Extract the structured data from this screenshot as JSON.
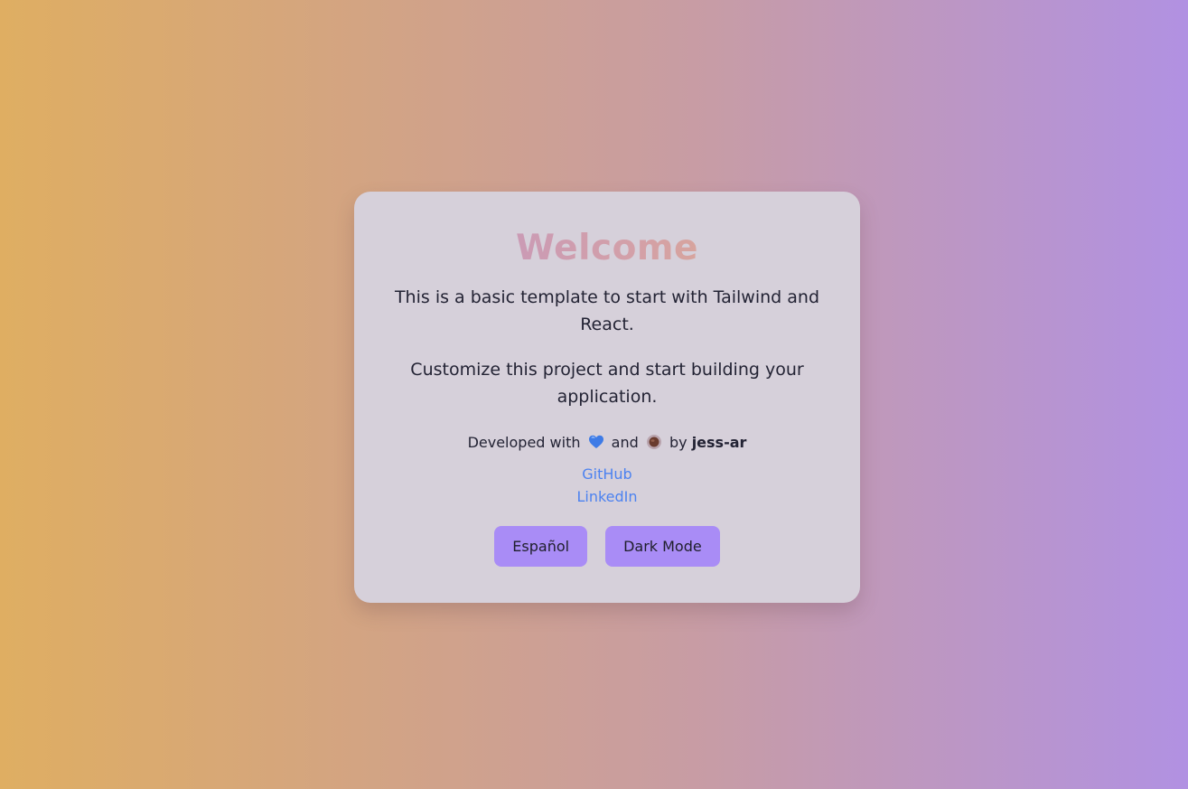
{
  "card": {
    "title": "Welcome",
    "paragraph_1": "This is a basic template to start with Tailwind and React.",
    "paragraph_2": "Customize this project and start building your application.",
    "credit": {
      "prefix": "Developed with",
      "heart_icon": "blue-heart-emoji",
      "connector": "and",
      "coffee_icon": "coffee-cup-emoji",
      "by": "by",
      "author": "jess-ar"
    },
    "links": [
      "GitHub",
      "LinkedIn"
    ],
    "buttons": {
      "language_label": "Español",
      "theme_label": "Dark Mode"
    }
  },
  "colors": {
    "background_gradient": [
      "#dfae62",
      "#b191e2"
    ],
    "card": "#d6d0da",
    "title_gradient": [
      "#bf93c6",
      "#e1ad84"
    ],
    "link": "#4c82f0",
    "button": "#a98cf6"
  }
}
